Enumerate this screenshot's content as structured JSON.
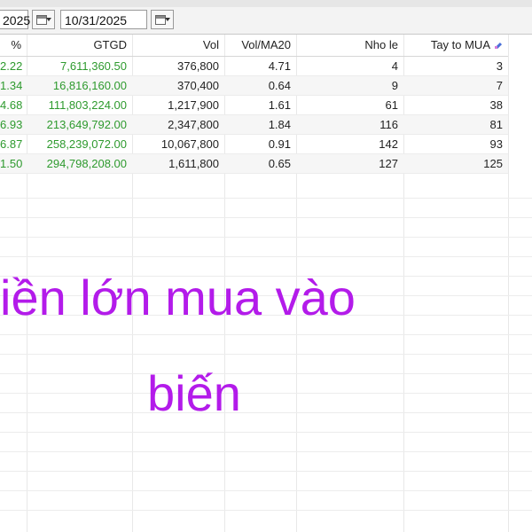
{
  "toolbar": {
    "start_date": "2025",
    "end_date": "10/31/2025"
  },
  "table": {
    "headers": [
      "%",
      "GTGD",
      "Vol",
      "Vol/MA20",
      "Nho le",
      "Tay to MUA"
    ],
    "rows": [
      [
        "2.22",
        "7,611,360.50",
        "376,800",
        "4.71",
        "4",
        "3"
      ],
      [
        "1.34",
        "16,816,160.00",
        "370,400",
        "0.64",
        "9",
        "7"
      ],
      [
        "4.68",
        "111,803,224.00",
        "1,217,900",
        "1.61",
        "61",
        "38"
      ],
      [
        "6.93",
        "213,649,792.00",
        "2,347,800",
        "1.84",
        "116",
        "81"
      ],
      [
        "6.87",
        "258,239,072.00",
        "10,067,800",
        "0.91",
        "142",
        "93"
      ],
      [
        "1.50",
        "294,798,208.00",
        "1,611,800",
        "0.65",
        "127",
        "125"
      ]
    ]
  },
  "overlay": {
    "line1": "iền lớn mua vào",
    "line2": "biến"
  },
  "colors": {
    "overlay_text": "#b31bea",
    "positive": "#2e9a2e"
  }
}
